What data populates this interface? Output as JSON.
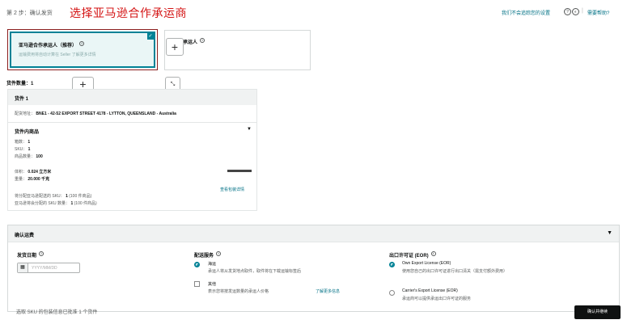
{
  "header": {
    "step_label": "第 2 步：确认发货",
    "annotation": "选择亚马逊合作承运商",
    "link_track": "我们不会追踪您的设置",
    "link_right": "需要帮助?"
  },
  "carrier_cards": {
    "partnered": {
      "title": "亚马逊合作承运人（推荐）",
      "desc": "运输费用将自动计算在 Seller 了解更多详情",
      "check": "✓"
    },
    "other": {
      "title": "承运人"
    }
  },
  "icons": {
    "plus": "+",
    "expand": "⤡",
    "info": "i",
    "calendar": "▦",
    "caret_down": "▼"
  },
  "shipments": {
    "count_label": "货件数量：1",
    "title": "货件 1",
    "ship_from_label": "配货地址：",
    "ship_from_value": "BNE1 - 42-52 EXPORT STREET 4178 - LYTTON, QUEENSLAND - Australia",
    "contents_title": "货件内商品",
    "boxes_label": "箱数：",
    "boxes_value": "1",
    "sku_label": "SKU：",
    "sku_value": "1",
    "units_label": "商品数量：",
    "units_value": "100",
    "volume_label": "体积：",
    "volume_value": "0.024 立方米",
    "weight_label": "重量：",
    "weight_value": "20.000 千克",
    "view_link": "查看包装详情",
    "note1_label": "将分配亚马逊配送的 SKU：",
    "note1_value": "1",
    "note1_suffix": "(100 件商品)",
    "note2_label": "亚马逊将会分配的 SKU 数量：",
    "note2_value": "1",
    "note2_suffix": "(100 件商品)"
  },
  "confirm": {
    "title": "确认运费",
    "ship_date_label": "发货日期",
    "date_placeholder": "YYYY/MM/DD",
    "service_title": "配送服务",
    "service_opt1_label": "海运",
    "service_opt1_desc": "承运人将从发货地点取件，取件将在下载运输标签后",
    "service_opt2_label": "其他",
    "service_opt2_desc": "表示您将按发运数量的承运人价格",
    "service_learn_more": "了解更多信息",
    "eor_title": "出口许可证 (EOR)",
    "eor_opt1_label": "Own Export License (EOR)",
    "eor_opt1_desc": "使用您自己的出口许可证进行出口清关（需支付额外费用）",
    "eor_opt2_label": "Carrier's Export License (EOR)",
    "eor_opt2_desc": "承运商可以提供承运出口许可证的服务"
  },
  "footer": {
    "note": "选取 SKU 的包装信息已批准 1 个货件",
    "confirm_button": "确认并继续"
  }
}
